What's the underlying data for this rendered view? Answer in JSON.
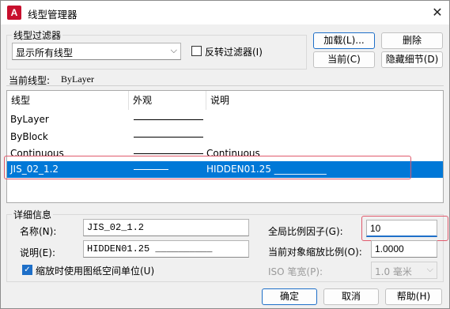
{
  "window": {
    "title": "线型管理器",
    "app_icon": "A"
  },
  "filter_group": {
    "label": "线型过滤器",
    "selected": "显示所有线型",
    "invert_label": "反转过滤器(I)",
    "invert_checked": false
  },
  "buttons": {
    "load": "加载(L)...",
    "delete": "删除",
    "current": "当前(C)",
    "hide_details": "隐藏细节(D)",
    "ok": "确定",
    "cancel": "取消",
    "help": "帮助(H)"
  },
  "current_linetype": {
    "label": "当前线型:",
    "value": "ByLayer"
  },
  "table": {
    "columns": [
      "线型",
      "外观",
      "说明"
    ],
    "rows": [
      {
        "name": "ByLayer",
        "description": "",
        "selected": false
      },
      {
        "name": "ByBlock",
        "description": "",
        "selected": false
      },
      {
        "name": "Continuous",
        "description": "Continuous",
        "selected": false
      },
      {
        "name": "JIS_02_1.2",
        "description": "HIDDEN01.25 ___________",
        "selected": true
      }
    ]
  },
  "details": {
    "label": "详细信息",
    "name_label": "名称(N):",
    "name_value": "JIS_02_1.2",
    "desc_label": "说明(E):",
    "desc_value": "HIDDEN01.25 __________",
    "paper_units_label": "缩放时使用图纸空间单位(U)",
    "paper_units_checked": true,
    "global_scale_label": "全局比例因子(G):",
    "global_scale_value": "10",
    "object_scale_label": "当前对象缩放比例(O):",
    "object_scale_value": "1.0000",
    "iso_pen_label": "ISO 笔宽(P):",
    "iso_pen_value": "1.0 毫米"
  },
  "colors": {
    "selection": "#0078d7",
    "highlight": "#e05a6c",
    "accent": "#1e6fc8"
  },
  "icons": {
    "close": "close-icon",
    "dropdown": "chevron-down-icon",
    "check": "check-icon"
  }
}
